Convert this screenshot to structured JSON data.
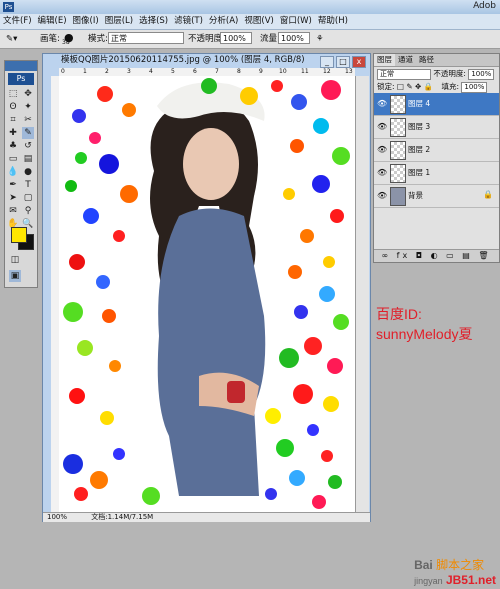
{
  "app": {
    "title": "Adob",
    "ps": "Ps"
  },
  "menu": [
    "文件(F)",
    "编辑(E)",
    "图像(I)",
    "图层(L)",
    "选择(S)",
    "滤镜(T)",
    "分析(A)",
    "视图(V)",
    "窗口(W)",
    "帮助(H)"
  ],
  "options": {
    "brush_label": "画笔:",
    "brush_size": "38",
    "mode_label": "模式:",
    "mode_value": "正常",
    "opacity_label": "不透明度:",
    "opacity_value": "100%",
    "flow_label": "流量:",
    "flow_value": "100%"
  },
  "document": {
    "title": "模板QQ图片20150620114755.jpg @ 100% (图层 4, RGB/8)",
    "zoom": "100%",
    "doc_size": "文档:1.14M/7.15M",
    "ruler_ticks": [
      "0",
      "1",
      "2",
      "3",
      "4",
      "5",
      "6",
      "7",
      "8",
      "9",
      "10",
      "11",
      "12",
      "13"
    ]
  },
  "layers_panel": {
    "tabs": [
      "图层",
      "通道",
      "路径"
    ],
    "blend_mode": "正常",
    "opacity_label": "不透明度:",
    "opacity_value": "100%",
    "lock_label": "锁定:",
    "fill_label": "填充:",
    "fill_value": "100%",
    "layers": [
      "图层 4",
      "图层 3",
      "图层 2",
      "图层 1",
      "背景"
    ],
    "bottom_icons": "∞ fx ◘ ◐ ▭ ▤ 🗑"
  },
  "watermark": {
    "line1": "百度ID:",
    "line2": "sunnyMelody夏",
    "footer_brand": "Bai",
    "footer_site": "脚本之家",
    "footer_url": "jingyan",
    "footer_domain": "JB51.net"
  },
  "colors": {
    "foreground": "#ffe600",
    "background": "#111111",
    "accent": "#3e78c4",
    "watermark": "#e0202a"
  }
}
